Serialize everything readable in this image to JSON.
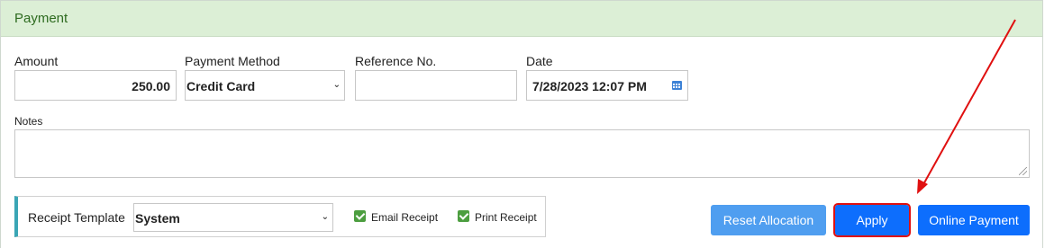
{
  "panel": {
    "title": "Payment"
  },
  "fields": {
    "amount": {
      "label": "Amount",
      "value": "250.00"
    },
    "payment_method": {
      "label": "Payment Method",
      "value": "Credit Card"
    },
    "reference": {
      "label": "Reference No.",
      "value": ""
    },
    "date": {
      "label": "Date",
      "value": "7/28/2023 12:07 PM"
    },
    "notes": {
      "label": "Notes",
      "value": ""
    }
  },
  "receipt": {
    "template_label": "Receipt Template",
    "template_value": "System",
    "email_label": "Email Receipt",
    "email_checked": true,
    "print_label": "Print Receipt",
    "print_checked": true
  },
  "buttons": {
    "reset": "Reset Allocation",
    "apply": "Apply",
    "online": "Online Payment"
  },
  "icons": {
    "dropdown": "chevron-down-icon",
    "date": "calendar-icon",
    "check": "checkmark-icon"
  },
  "colors": {
    "header_bg": "#dcefd6",
    "header_text": "#2e6b20",
    "primary": "#0d6efd",
    "secondary_btn": "#4f9ef0",
    "checkbox": "#4c9e3f",
    "annotation": "#e01010"
  }
}
